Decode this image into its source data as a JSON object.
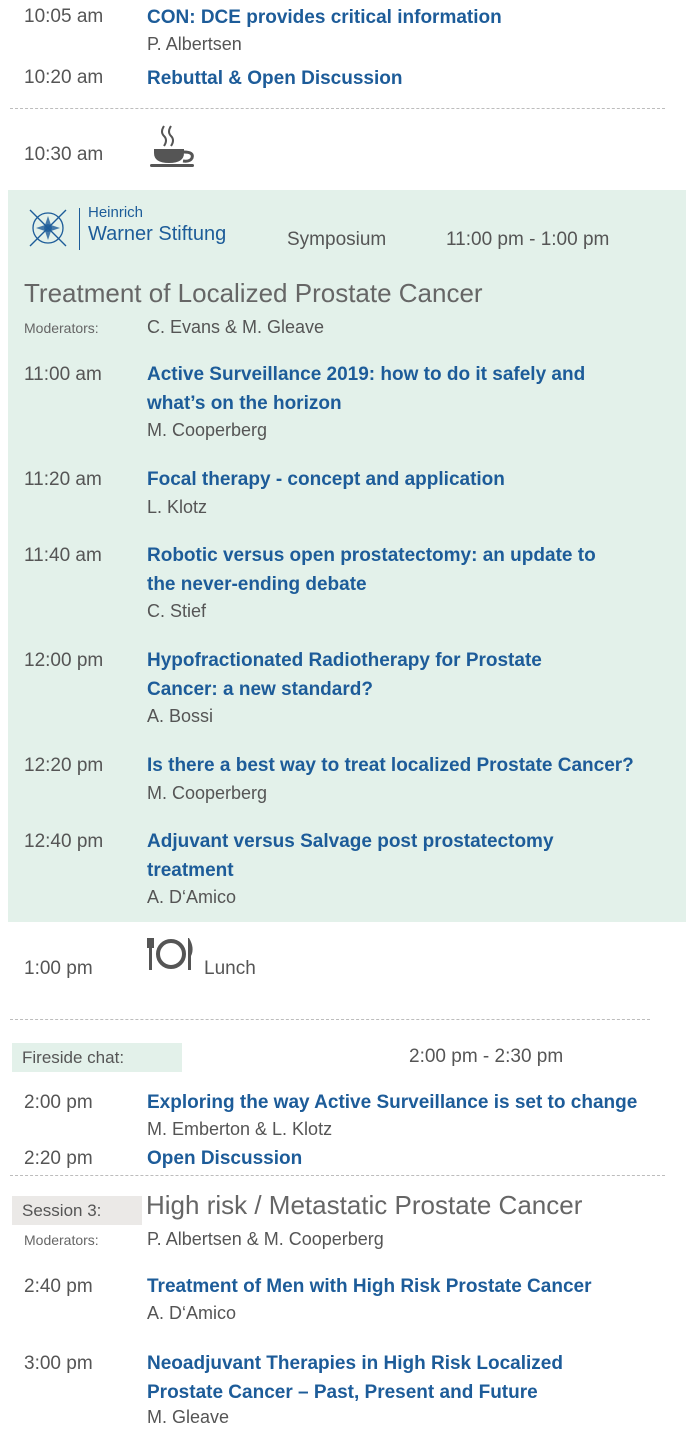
{
  "top": {
    "items": [
      {
        "time": "10:05 am",
        "title": "CON: DCE provides critical information",
        "speaker": "P. Albertsen"
      },
      {
        "time": "10:20 am",
        "title": "Rebuttal & Open Discussion"
      }
    ],
    "break_time": "10:30 am",
    "break_icon": "coffee-cup-icon"
  },
  "symposium": {
    "logo_line1": "Heinrich",
    "logo_line2": "Warner Stiftung",
    "label": "Symposium",
    "time_range": "11:00 pm - 1:00 pm",
    "title": "Treatment of Localized Prostate Cancer",
    "moderators_label": "Moderators:",
    "moderators": "C. Evans & M. Gleave",
    "items": [
      {
        "time": "11:00 am",
        "title_l1": "Active Surveillance 2019: how to do it safely and",
        "title_l2": "what’s on the horizon",
        "speaker": "M. Cooperberg"
      },
      {
        "time": "11:20 am",
        "title_l1": "Focal therapy - concept and application",
        "speaker": "L. Klotz"
      },
      {
        "time": "11:40 am",
        "title_l1": "Robotic versus open prostatectomy: an update to",
        "title_l2": "the never-ending debate",
        "speaker": "C. Stief"
      },
      {
        "time": "12:00 pm",
        "title_l1": "Hypofractionated Radiotherapy for Prostate",
        "title_l2": "Cancer: a new standard?",
        "speaker": "A. Bossi"
      },
      {
        "time": "12:20 pm",
        "title_l1": "Is there a best way to treat localized Prostate Cancer?",
        "speaker": "M. Cooperberg"
      },
      {
        "time": "12:40 pm",
        "title_l1": "Adjuvant versus Salvage post prostatectomy",
        "title_l2": "treatment",
        "speaker": "A. D‘Amico"
      }
    ],
    "colors": {
      "band": "#e3f1ea",
      "title": "#1d5c99"
    }
  },
  "lunch": {
    "time": "1:00 pm",
    "label": "Lunch",
    "icon": "plate-cutlery-icon"
  },
  "fireside": {
    "label": "Fireside chat:",
    "time_range": "2:00 pm - 2:30 pm",
    "items": [
      {
        "time": "2:00 pm",
        "title": "Exploring the way Active Surveillance is set to change",
        "speaker": "M. Emberton & L. Klotz"
      },
      {
        "time": "2:20 pm",
        "title": "Open Discussion"
      }
    ]
  },
  "session3": {
    "label": "Session 3:",
    "title": "High risk / Metastatic Prostate Cancer",
    "moderators_label": "Moderators:",
    "moderators": "P. Albertsen & M. Cooperberg",
    "items": [
      {
        "time": "2:40 pm",
        "title_l1": "Treatment of Men with High Risk Prostate Cancer",
        "speaker": "A. D‘Amico"
      },
      {
        "time": "3:00 pm",
        "title_l1": "Neoadjuvant Therapies in High Risk Localized",
        "title_l2": "Prostate Cancer – Past, Present and Future",
        "speaker": "M. Gleave"
      }
    ]
  }
}
